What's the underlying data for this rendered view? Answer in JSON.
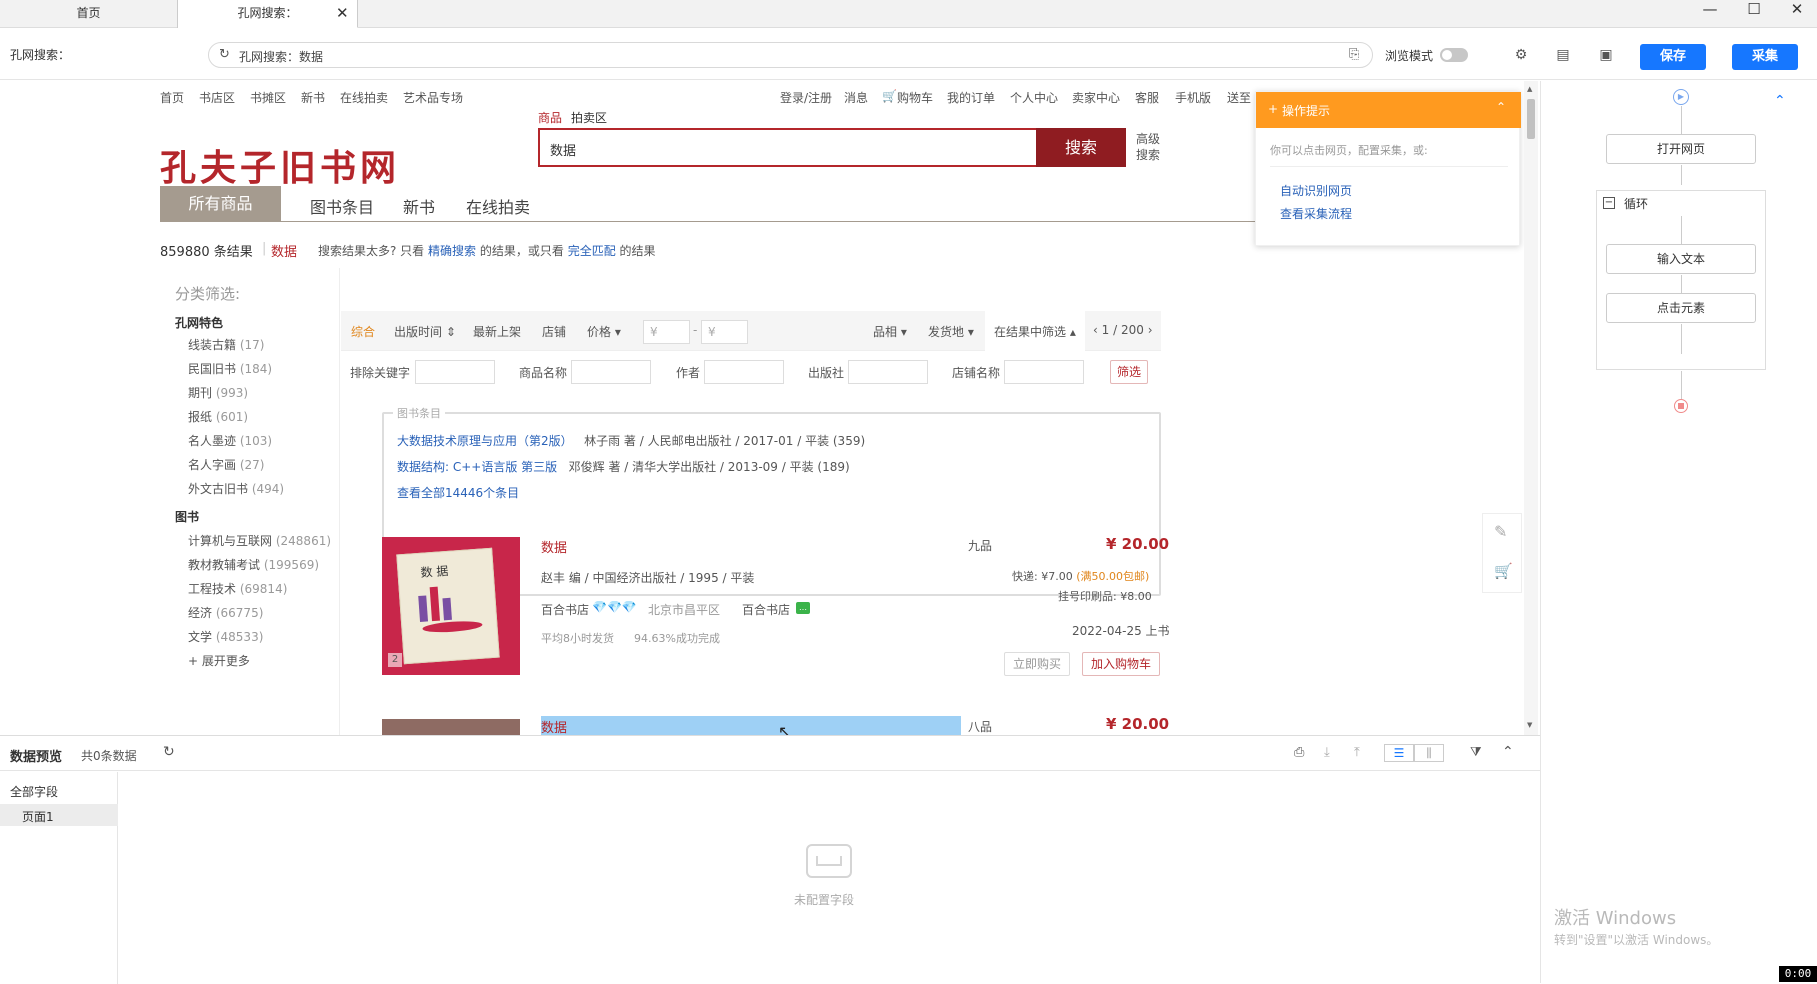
{
  "tabs": [
    {
      "label": "首页"
    },
    {
      "label": "孔网搜索："
    }
  ],
  "addr": {
    "page_label": "孔网搜索：",
    "url_text": "孔网搜索：数据",
    "browse_mode": "浏览模式",
    "save": "保存",
    "collect": "采集"
  },
  "site": {
    "nav_left": [
      "首页",
      "书店区",
      "书摊区",
      "新书",
      "在线拍卖",
      "艺术品专场"
    ],
    "nav_right": [
      "登录/注册",
      "消息",
      "购物车",
      "我的订单",
      "个人中心",
      "卖家中心",
      "客服",
      "手机版",
      "送至"
    ],
    "logo": "孔夫子旧书网",
    "search_tabs": [
      "商品",
      "拍卖区"
    ],
    "search_value": "数据",
    "search_btn": "搜索",
    "adv_search": [
      "高级",
      "搜索"
    ],
    "main_tabs": [
      "所有商品",
      "图书条目",
      "新书",
      "在线拍卖"
    ],
    "result_count": "859880 条结果",
    "result_keyword": "数据",
    "result_hint_1": "搜索结果太多? 只看",
    "result_hint_link1": "精确搜索",
    "result_hint_2": "的结果，或只看",
    "result_hint_link2": "完全匹配",
    "result_hint_3": "的结果"
  },
  "sidebar": {
    "title": "分类筛选:",
    "group1": "孔网特色",
    "group1_items": [
      {
        "name": "线装古籍",
        "count": "(17)"
      },
      {
        "name": "民国旧书",
        "count": "(184)"
      },
      {
        "name": "期刊",
        "count": "(993)"
      },
      {
        "name": "报纸",
        "count": "(601)"
      },
      {
        "name": "名人墨迹",
        "count": "(103)"
      },
      {
        "name": "名人字画",
        "count": "(27)"
      },
      {
        "name": "外文古旧书",
        "count": "(494)"
      }
    ],
    "group2": "图书",
    "group2_items": [
      {
        "name": "计算机与互联网",
        "count": "(248861)"
      },
      {
        "name": "教材教辅考试",
        "count": "(199569)"
      },
      {
        "name": "工程技术",
        "count": "(69814)"
      },
      {
        "name": "经济",
        "count": "(66775)"
      },
      {
        "name": "文学",
        "count": "(48533)"
      }
    ],
    "more": "+ 展开更多"
  },
  "filter": {
    "sorts": [
      "综合",
      "出版时间",
      "最新上架",
      "店铺",
      "价格"
    ],
    "price_placeholder": "¥",
    "right": [
      "品相",
      "发货地",
      "在结果中筛选"
    ],
    "pager": "1 / 200",
    "fields": [
      "排除关键字",
      "商品名称",
      "作者",
      "出版社",
      "店铺名称"
    ],
    "filter_btn": "筛选"
  },
  "book_entries": {
    "legend": "图书条目",
    "item1_title": "大数据技术原理与应用（第2版）",
    "item1_meta": "林子雨 著 / 人民邮电出版社 / 2017-01 / 平装 (359)",
    "item2_title": "数据结构: C++语言版 第三版",
    "item2_meta": "邓俊辉 著 / 清华大学出版社 / 2013-09 / 平装 (189)",
    "all": "查看全部14446个条目"
  },
  "product1": {
    "title": "数据",
    "condition": "九品",
    "price": "¥ 20.00",
    "meta": "赵丰 编 / 中国经济出版社 / 1995 / 平装",
    "shipping": "快递: ¥7.00",
    "free": "(满50.00包邮)",
    "registered": "挂号印刷品: ¥8.00",
    "shop": "百合书店",
    "location": "北京市昌平区",
    "shop2": "百合书店",
    "delivery": "平均8小时发货",
    "success": "94.63%成功完成",
    "date": "2022-04-25 上书",
    "buy": "立即购买",
    "cart": "加入购物车",
    "cover_title": "数 据",
    "img_count": "2"
  },
  "product2": {
    "title": "数据",
    "condition": "八品",
    "price": "¥ 20.00"
  },
  "tooltip": "数据",
  "ops_tip": {
    "title": "操作提示",
    "desc": "你可以点击网页，配置采集，或:",
    "link1": "自动识别网页",
    "link2": "查看采集流程"
  },
  "flow": {
    "open": "打开网页",
    "loop": "循环",
    "input": "输入文本",
    "click": "点击元素"
  },
  "bottom": {
    "title": "数据预览",
    "count": "共0条数据",
    "all_fields": "全部字段",
    "page1": "页面1",
    "empty": "未配置字段"
  },
  "watermark": {
    "line1": "激活 Windows",
    "line2": "转到\"设置\"以激活 Windows。"
  },
  "clock": "0:00",
  "colors": {
    "accent": "#1677ff",
    "brand_red": "#b4262b",
    "orange": "#ff9a1f"
  }
}
